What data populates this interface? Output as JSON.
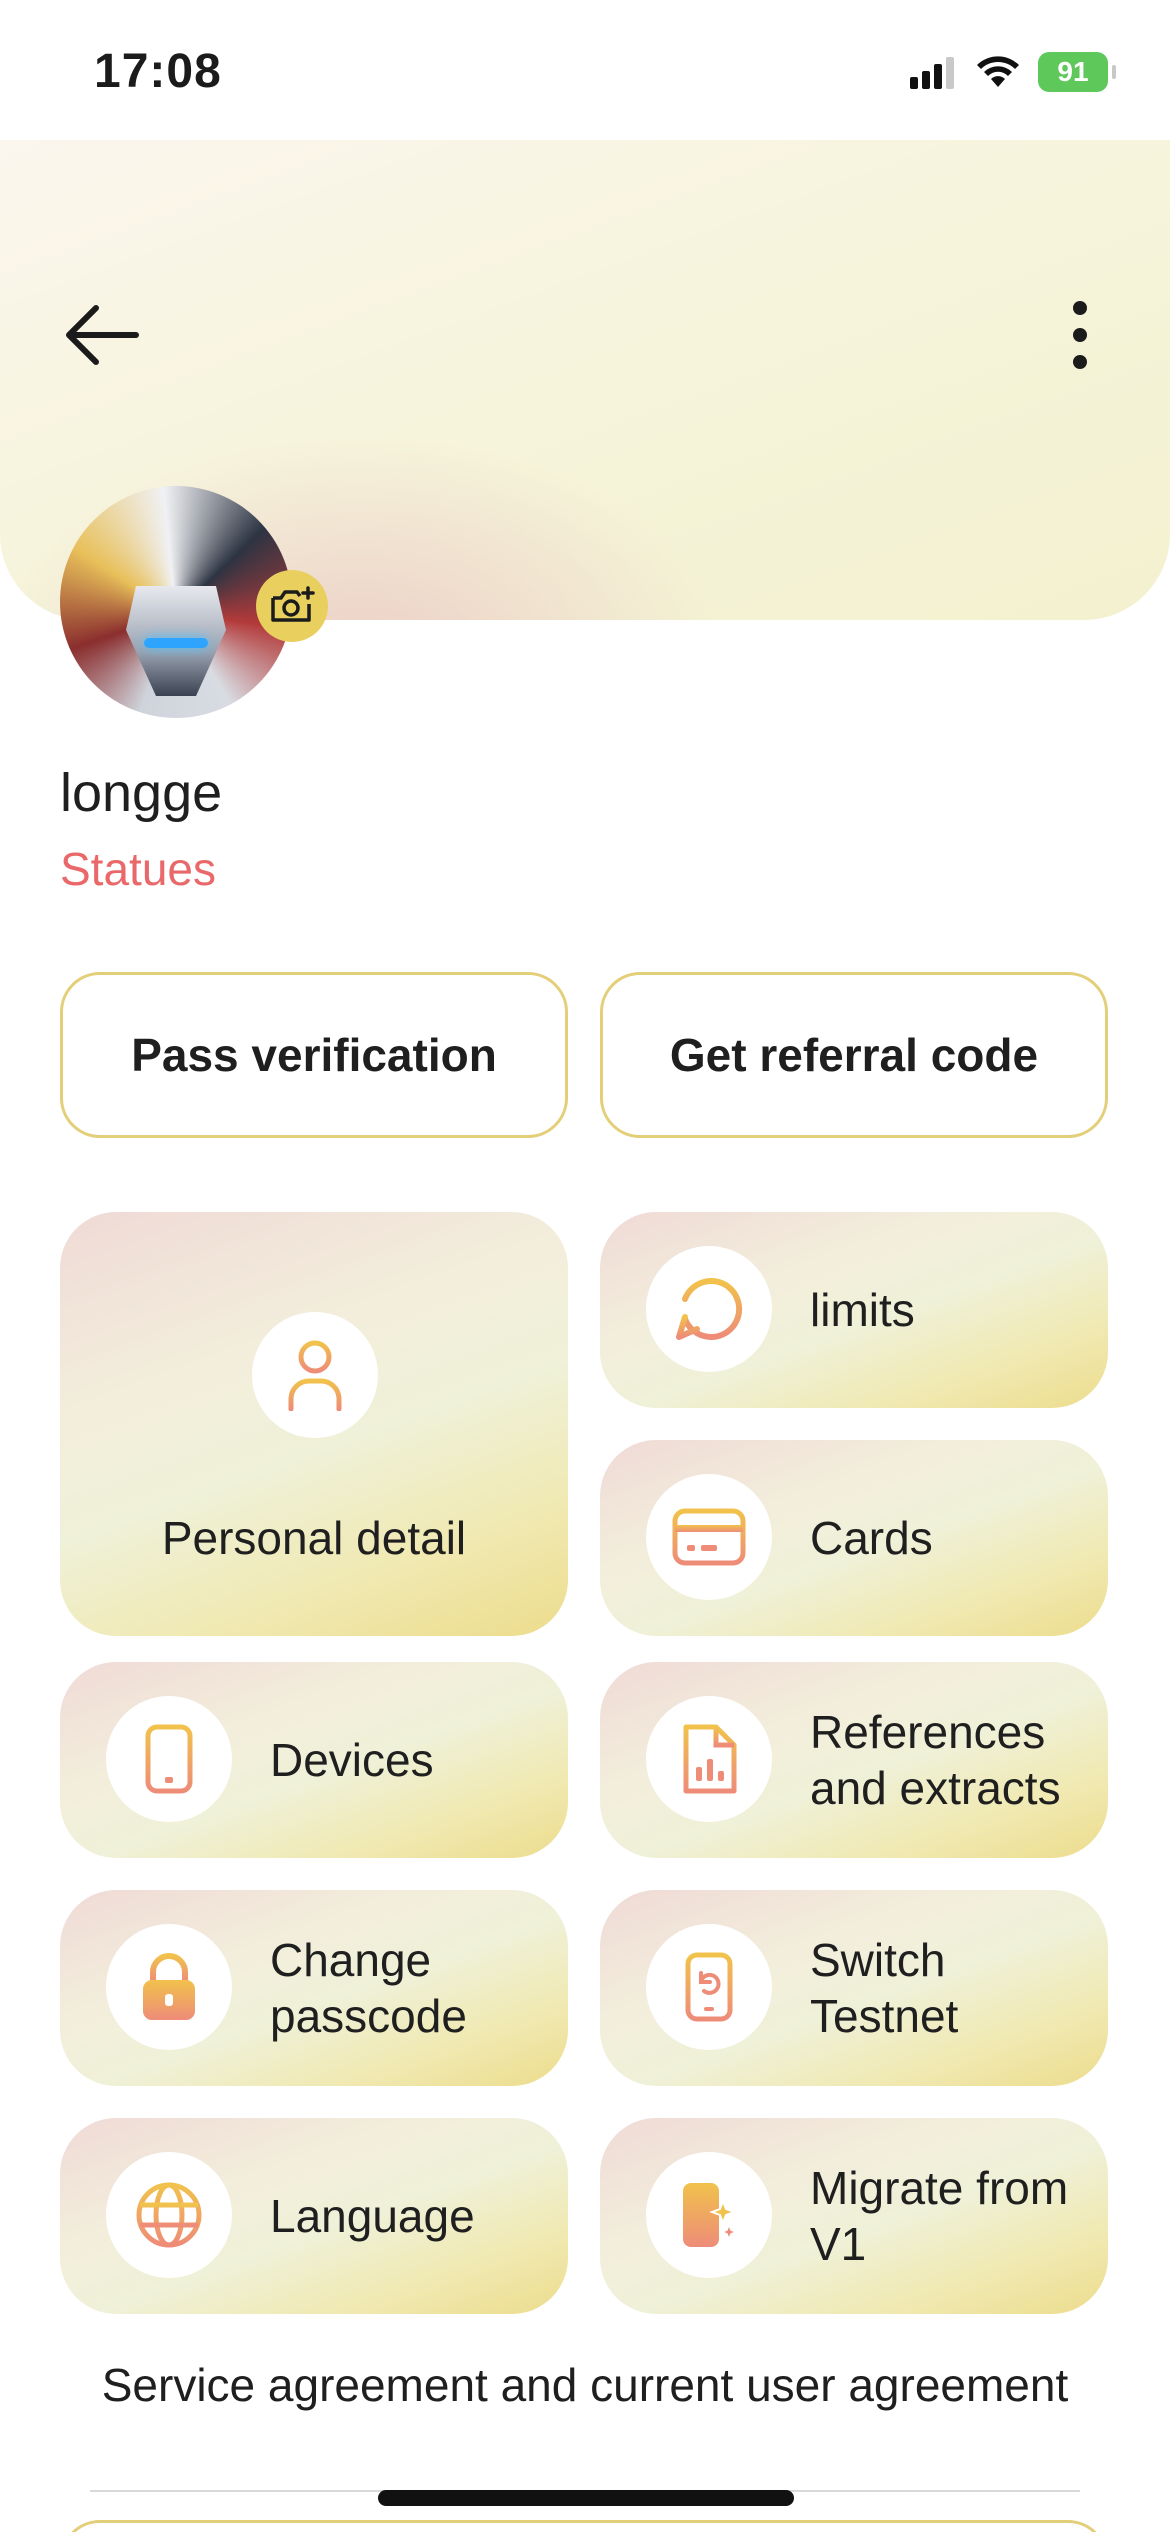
{
  "status_bar": {
    "time": "17:08",
    "battery": "91"
  },
  "header": {
    "back_icon": "arrow-left-icon",
    "more_icon": "more-vertical-icon",
    "camera_icon": "camera-add-icon"
  },
  "profile": {
    "name": "longge",
    "status": "Statues"
  },
  "actions": {
    "pass_verification": "Pass verification",
    "referral": "Get referral code"
  },
  "tiles": {
    "personal_detail": "Personal detail",
    "limits": "limits",
    "cards": "Cards",
    "devices": "Devices",
    "references": "References and extracts",
    "change_passcode": "Change passcode",
    "switch_testnet": "Switch Testnet",
    "language": "Language",
    "migrate": "Migrate from V1"
  },
  "footer": {
    "agreement": "Service agreement and current user agreement"
  },
  "colors": {
    "accent_gold": "#e3cf79",
    "status_red": "#e9696b",
    "icon_gradient_start": "#f1c24c",
    "icon_gradient_end": "#ee8c78"
  }
}
